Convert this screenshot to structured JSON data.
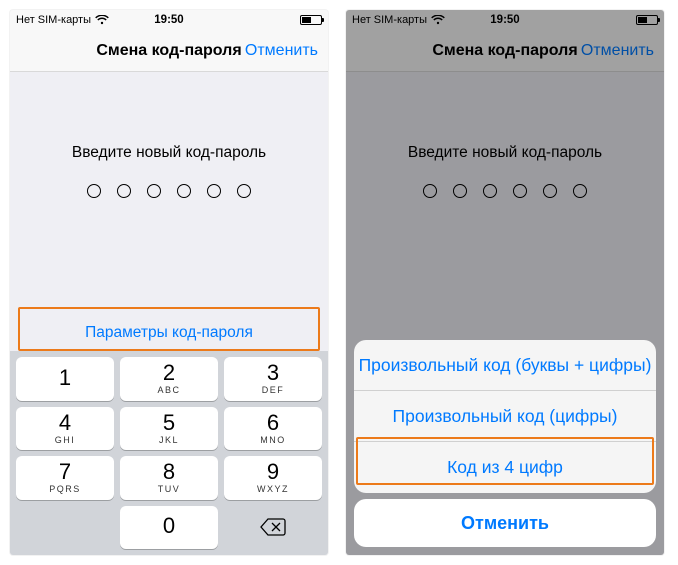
{
  "status": {
    "carrier": "Нет SIM-карты",
    "time": "19:50"
  },
  "nav": {
    "title": "Смена код-пароля",
    "cancel": "Отменить"
  },
  "prompt": "Введите новый код-пароль",
  "options_link": "Параметры код-пароля",
  "keypad": {
    "k1": {
      "num": "1",
      "letters": ""
    },
    "k2": {
      "num": "2",
      "letters": "ABC"
    },
    "k3": {
      "num": "3",
      "letters": "DEF"
    },
    "k4": {
      "num": "4",
      "letters": "GHI"
    },
    "k5": {
      "num": "5",
      "letters": "JKL"
    },
    "k6": {
      "num": "6",
      "letters": "MNO"
    },
    "k7": {
      "num": "7",
      "letters": "PQRS"
    },
    "k8": {
      "num": "8",
      "letters": "TUV"
    },
    "k9": {
      "num": "9",
      "letters": "WXYZ"
    },
    "k0": {
      "num": "0",
      "letters": ""
    }
  },
  "sheet": {
    "opt1": "Произвольный код (буквы + цифры)",
    "opt2": "Произвольный код (цифры)",
    "opt3": "Код из 4 цифр",
    "cancel": "Отменить"
  }
}
